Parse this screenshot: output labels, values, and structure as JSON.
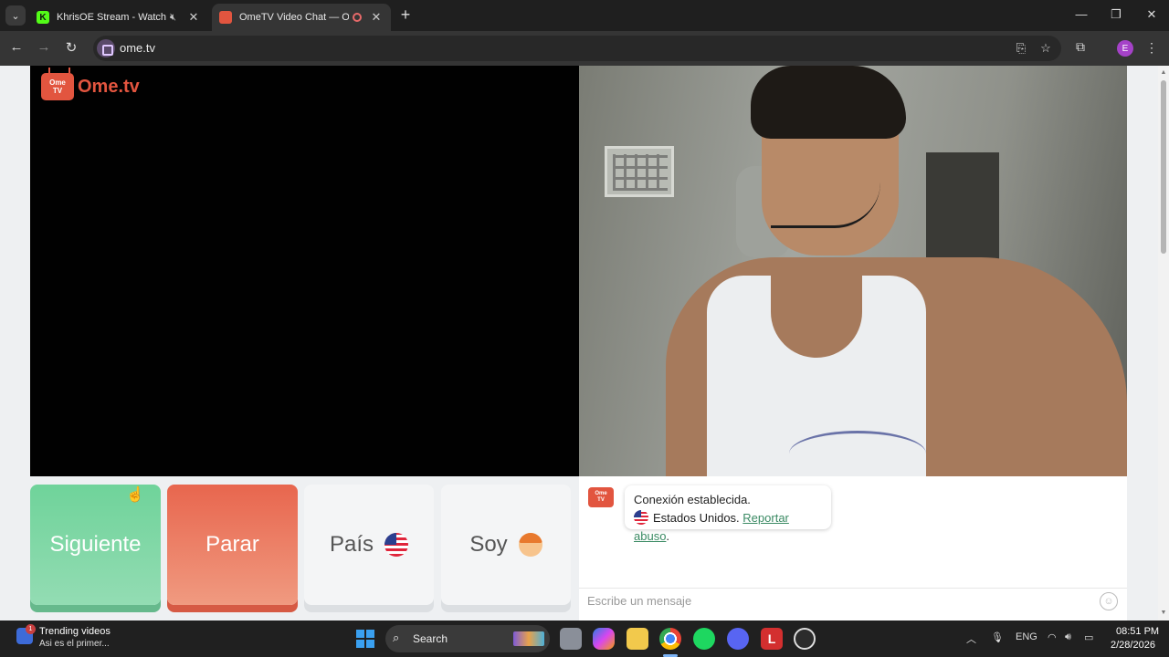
{
  "browser": {
    "tabs": [
      {
        "title": "KhrisOE Stream - Watch Live",
        "favicon": "K"
      },
      {
        "title": "OmeTV Video Chat — Omegle"
      }
    ],
    "url": "ome.tv",
    "profile_initial": "E"
  },
  "page": {
    "logo": {
      "badge_line1": "Ome",
      "badge_line2": "TV",
      "text": "Ome.tv"
    },
    "buttons": {
      "next": "Siguiente",
      "stop": "Parar",
      "country": "País",
      "gender": "Soy"
    },
    "chat": {
      "logo_line1": "Ome",
      "logo_line2": "TV",
      "message_line1": "Conexión establecida.",
      "country": "Estados Unidos.",
      "report_link": "Reportar abuso",
      "report_suffix": ".",
      "placeholder": "Escribe un mensaje"
    }
  },
  "taskbar": {
    "widget_badge": "1",
    "trending_title": "Trending videos",
    "trending_sub": "Asi es el primer...",
    "search_label": "Search",
    "language": "ENG",
    "time": "08:51 PM",
    "date": "2/28/2026"
  },
  "colors": {
    "next_button": "#6fd39a",
    "stop_button": "#e8664e",
    "brand": "#e2553f",
    "report_link": "#3a8a63"
  }
}
